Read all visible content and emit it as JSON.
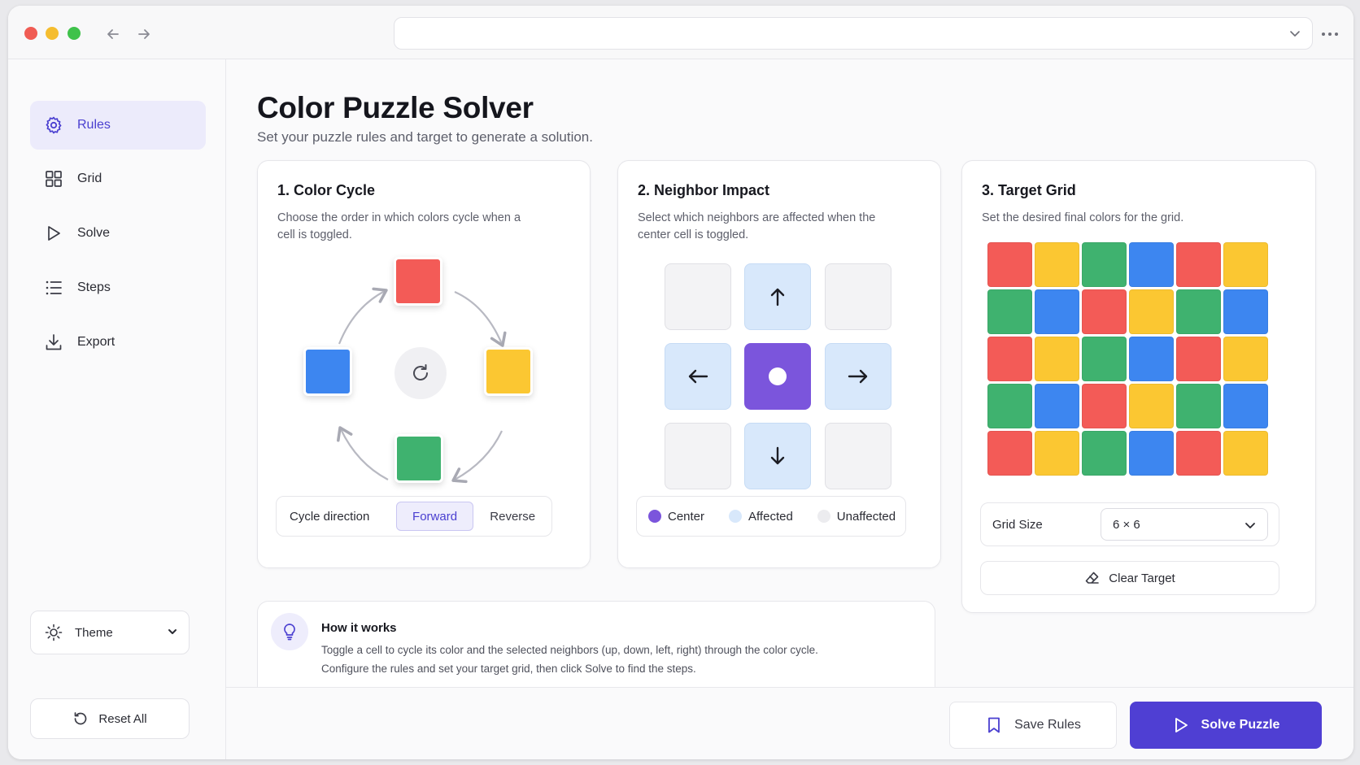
{
  "window": {
    "url_value": ""
  },
  "sidebar": {
    "items": [
      {
        "label": "Rules",
        "icon": "gear-icon",
        "active": true
      },
      {
        "label": "Grid",
        "icon": "grid-icon",
        "active": false
      },
      {
        "label": "Solve",
        "icon": "play-icon",
        "active": false
      },
      {
        "label": "Steps",
        "icon": "list-icon",
        "active": false
      },
      {
        "label": "Export",
        "icon": "download-icon",
        "active": false
      }
    ],
    "theme_label": "Theme",
    "reset_label": "Reset All"
  },
  "page": {
    "title": "Color Puzzle Solver",
    "subtitle": "Set your puzzle rules and target to generate a solution."
  },
  "color_cycle": {
    "title": "1. Color Cycle",
    "description": "Choose the order in which colors cycle when a cell is toggled.",
    "colors": [
      "#f35b57",
      "#fbc732",
      "#3fb26f",
      "#3d86f0"
    ],
    "direction_label": "Cycle direction",
    "forward_label": "Forward",
    "reverse_label": "Reverse",
    "selected_direction": "Forward"
  },
  "neighbor_impact": {
    "title": "2. Neighbor Impact",
    "description": "Select which neighbors are affected when the center cell is toggled.",
    "cells": [
      "unaffected",
      "affected",
      "unaffected",
      "affected",
      "center",
      "affected",
      "unaffected",
      "affected",
      "unaffected"
    ],
    "legend": {
      "center": "Center",
      "affected": "Affected",
      "unaffected": "Unaffected"
    },
    "colors": {
      "center": "#7b55dc",
      "affected": "#d8e8fb",
      "unaffected": "#ececef"
    }
  },
  "target_grid": {
    "title": "3. Target Grid",
    "description": "Set the desired final colors for the grid.",
    "palette": {
      "R": "#f35b57",
      "Y": "#fbc732",
      "G": "#3fb26f",
      "B": "#3d86f0"
    },
    "rows": [
      [
        "R",
        "Y",
        "G",
        "B",
        "R",
        "Y"
      ],
      [
        "G",
        "B",
        "R",
        "Y",
        "G",
        "B"
      ],
      [
        "R",
        "Y",
        "G",
        "B",
        "R",
        "Y"
      ],
      [
        "G",
        "B",
        "R",
        "Y",
        "G",
        "B"
      ],
      [
        "R",
        "Y",
        "G",
        "B",
        "R",
        "Y"
      ]
    ],
    "size_label": "Grid Size",
    "size_value": "6 × 6",
    "clear_label": "Clear Target"
  },
  "how_it_works": {
    "title": "How it works",
    "line1": "Toggle a cell to cycle its color and the selected neighbors (up, down, left, right) through the color cycle.",
    "line2": "Configure the rules and set your target grid, then click Solve to find the steps."
  },
  "footer": {
    "save_label": "Save Rules",
    "solve_label": "Solve Puzzle"
  },
  "accent_color": "#4f3fd3"
}
